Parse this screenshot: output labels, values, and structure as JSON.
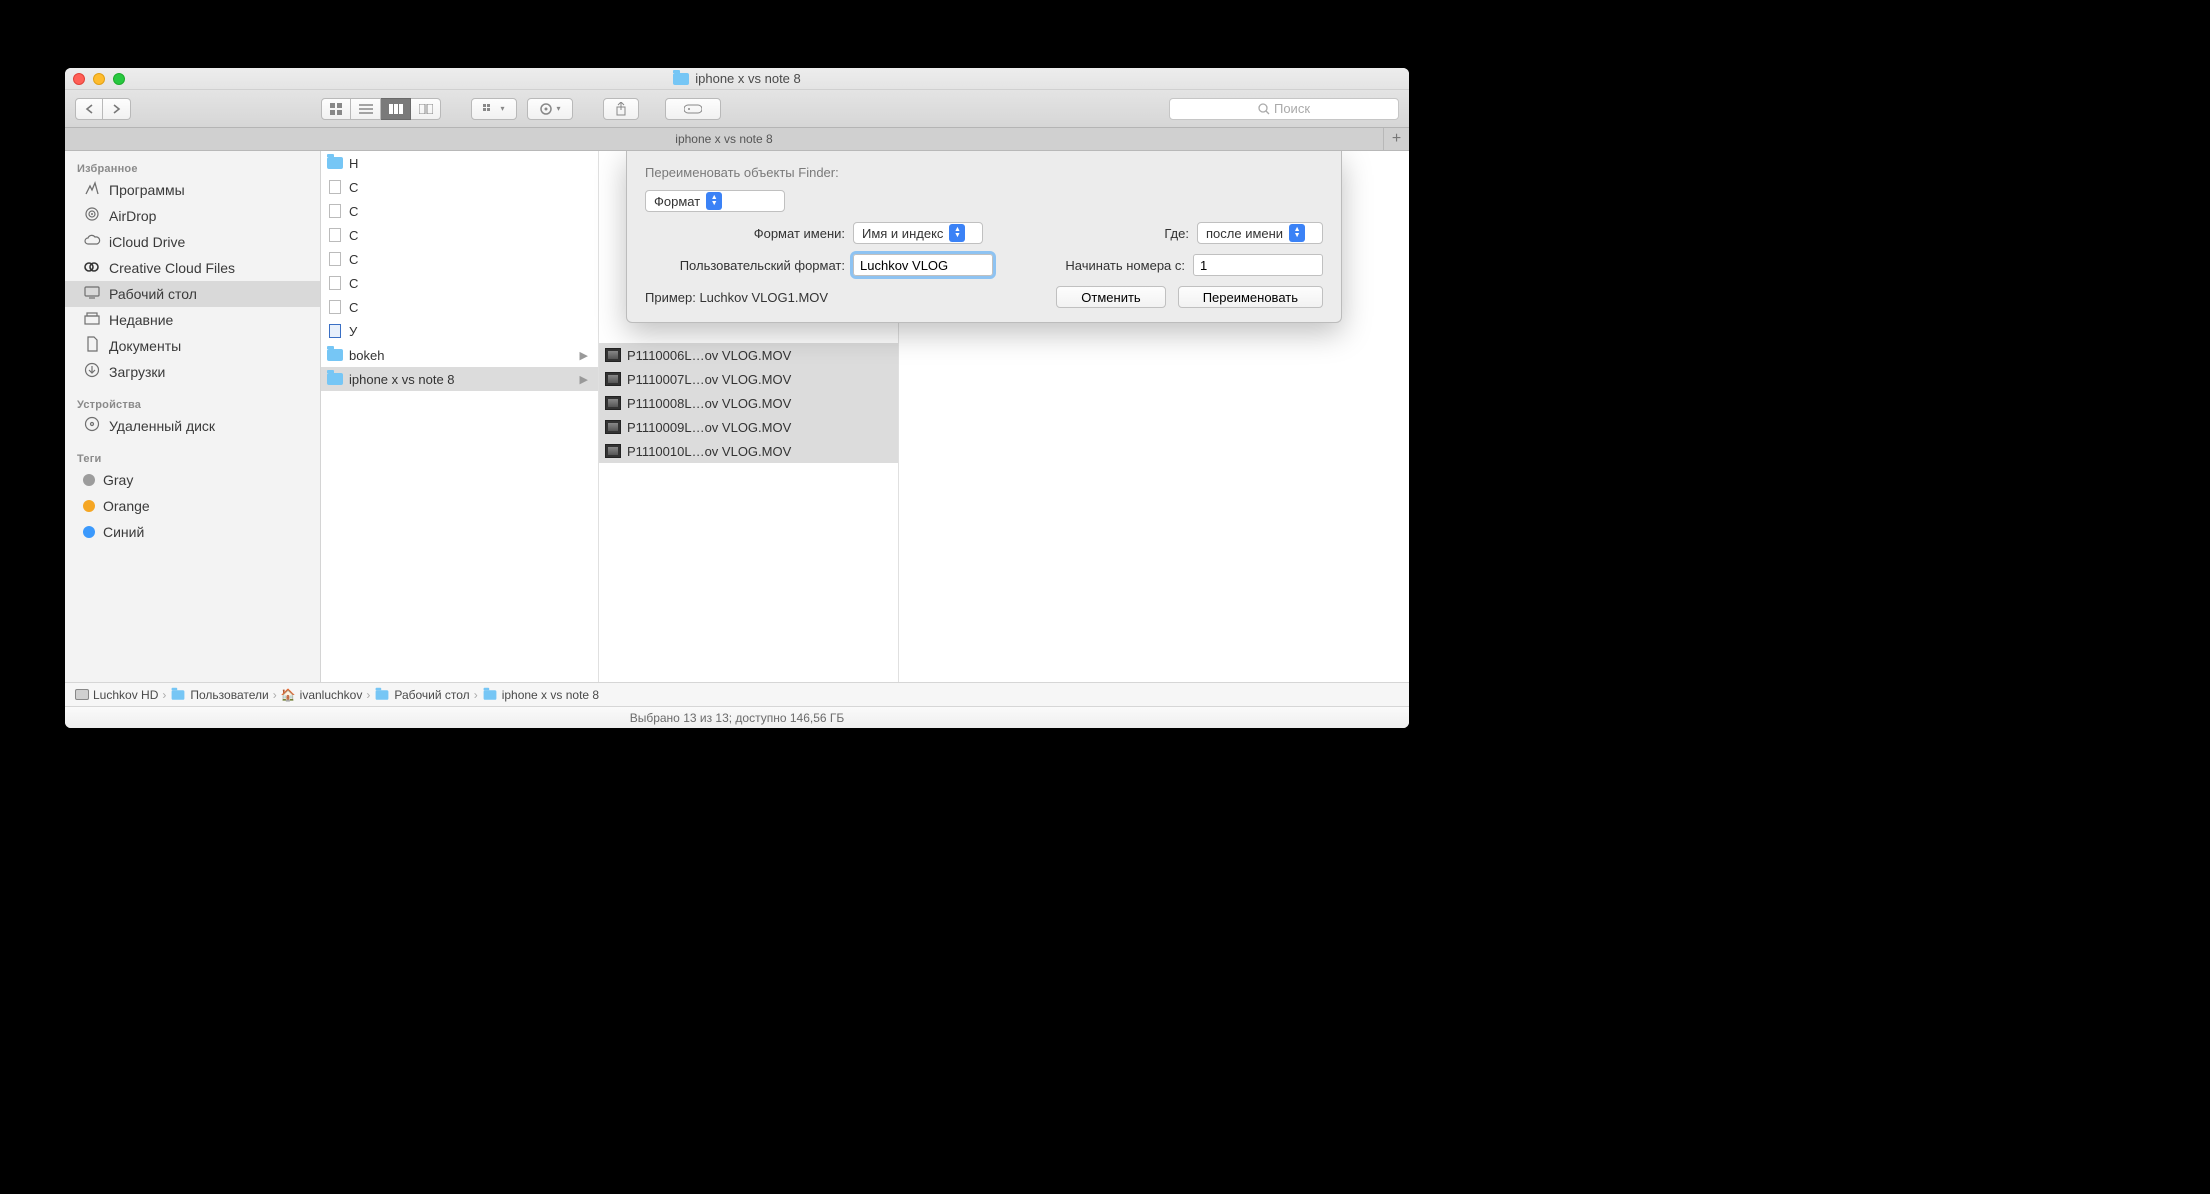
{
  "window": {
    "title": "iphone x vs note 8"
  },
  "toolbar": {
    "search_placeholder": "Поиск"
  },
  "tabbar": {
    "tab_label": "iphone x vs note 8"
  },
  "sidebar": {
    "favorites_header": "Избранное",
    "items": [
      {
        "icon": "apps",
        "label": "Программы"
      },
      {
        "icon": "airdrop",
        "label": "AirDrop"
      },
      {
        "icon": "cloud",
        "label": "iCloud Drive"
      },
      {
        "icon": "cc",
        "label": "Creative Cloud Files"
      },
      {
        "icon": "desktop",
        "label": "Рабочий стол",
        "selected": true
      },
      {
        "icon": "recent",
        "label": "Недавние"
      },
      {
        "icon": "docs",
        "label": "Документы"
      },
      {
        "icon": "downloads",
        "label": "Загрузки"
      }
    ],
    "devices_header": "Устройства",
    "devices": [
      {
        "icon": "disc",
        "label": "Удаленный диск"
      }
    ],
    "tags_header": "Теги",
    "tags": [
      {
        "color": "#9c9c9c",
        "label": "Gray"
      },
      {
        "color": "#f5a623",
        "label": "Orange"
      },
      {
        "color": "#3b99fc",
        "label": "Синий"
      }
    ]
  },
  "column1": [
    {
      "type": "folder",
      "label": "Н"
    },
    {
      "type": "doc",
      "label": "С"
    },
    {
      "type": "doc",
      "label": "С"
    },
    {
      "type": "doc",
      "label": "С"
    },
    {
      "type": "doc",
      "label": "С"
    },
    {
      "type": "doc",
      "label": "С"
    },
    {
      "type": "doc",
      "label": "С"
    },
    {
      "type": "word",
      "label": "У"
    },
    {
      "type": "folder",
      "label": "bokeh",
      "arrow": true
    },
    {
      "type": "folder",
      "label": "iphone x vs note 8",
      "selected": true,
      "arrow": true
    }
  ],
  "column2": [
    {
      "label": "P1110006L…ov VLOG.MOV",
      "selected": true
    },
    {
      "label": "P1110007L…ov VLOG.MOV",
      "selected": true
    },
    {
      "label": "P1110008L…ov VLOG.MOV",
      "selected": true
    },
    {
      "label": "P1110009L…ov VLOG.MOV",
      "selected": true
    },
    {
      "label": "P1110010L…ov VLOG.MOV",
      "selected": true
    }
  ],
  "dialog": {
    "title": "Переименовать объекты Finder:",
    "mode_select": "Формат",
    "name_format_label": "Формат имени:",
    "name_format_value": "Имя и индекс",
    "where_label": "Где:",
    "where_value": "после имени",
    "custom_format_label": "Пользовательский формат:",
    "custom_format_value": "Luchkov VLOG",
    "start_number_label": "Начинать номера с:",
    "start_number_value": "1",
    "example_label": "Пример: Luchkov VLOG1.MOV",
    "cancel": "Отменить",
    "rename": "Переименовать"
  },
  "pathbar": [
    {
      "icon": "hd",
      "label": "Luchkov HD"
    },
    {
      "icon": "folder",
      "label": "Пользователи"
    },
    {
      "icon": "home",
      "label": "ivanluchkov"
    },
    {
      "icon": "folder",
      "label": "Рабочий стол"
    },
    {
      "icon": "folder",
      "label": "iphone x vs note 8"
    }
  ],
  "statusbar": {
    "text": "Выбрано 13 из 13; доступно 146,56 ГБ"
  }
}
